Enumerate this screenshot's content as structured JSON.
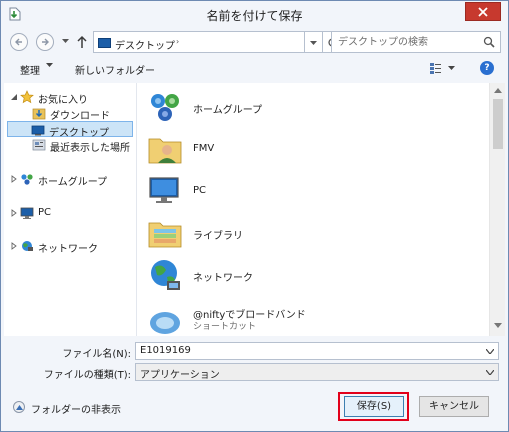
{
  "window": {
    "title": "名前を付けて保存",
    "close_icon": "close-icon"
  },
  "address_bar": {
    "path": "デスクトップ",
    "separator": "›"
  },
  "search": {
    "placeholder": "デスクトップの検索"
  },
  "toolbar": {
    "organize_label": "整理",
    "new_folder_label": "新しいフォルダー",
    "help_label": "?"
  },
  "nav_pane": {
    "items": [
      {
        "label": "お気に入り",
        "icon": "star-icon"
      },
      {
        "label": "ダウンロード",
        "icon": "download-folder-icon"
      },
      {
        "label": "デスクトップ",
        "icon": "desktop-icon"
      },
      {
        "label": "最近表示した場所",
        "icon": "recent-places-icon"
      },
      {
        "label": "ホームグループ",
        "icon": "homegroup-icon"
      },
      {
        "label": "PC",
        "icon": "computer-icon"
      },
      {
        "label": "ネットワーク",
        "icon": "network-icon"
      }
    ]
  },
  "content": {
    "items": [
      {
        "name": "ホームグループ",
        "icon": "homegroup-icon"
      },
      {
        "name": "FMV",
        "icon": "user-folder-icon"
      },
      {
        "name": "PC",
        "icon": "computer-icon"
      },
      {
        "name": "ライブラリ",
        "icon": "library-icon"
      },
      {
        "name": "ネットワーク",
        "icon": "network-icon"
      },
      {
        "name": "@niftyでブロードバンド",
        "sub": "ショートカット",
        "icon": "shortcut-icon"
      }
    ]
  },
  "form": {
    "filename_label": "ファイル名(N):",
    "filename_value": "E1019169",
    "filetype_label": "ファイルの種類(T):",
    "filetype_value": "アプリケーション"
  },
  "footer": {
    "hide_folders_label": "フォルダーの非表示",
    "save_label": "保存(S)",
    "cancel_label": "キャンセル"
  },
  "colors": {
    "accent": "#2a6fd0",
    "selection": "#cce4f7",
    "highlight_box": "#e2001a",
    "close_button": "#c7392e"
  }
}
